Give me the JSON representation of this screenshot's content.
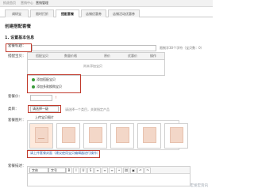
{
  "topbar": {
    "breadcrumb": [
      "抓虎首页",
      "营销中心",
      "营销管理"
    ]
  },
  "tabs": [
    {
      "label": "调研宝"
    },
    {
      "label": "限时打折"
    },
    {
      "label": "搭配套餐"
    },
    {
      "label": "店铺优惠券"
    },
    {
      "label": "店铺活动优惠券"
    }
  ],
  "page": {
    "title": "创建搭配套餐",
    "section": "1. 设置基本信息"
  },
  "form": {
    "name_label": "套餐标题：",
    "name_value": "",
    "name_hint": "限制字30个字符（宝贝数：0）",
    "items_label": "搭配宝贝：",
    "table_headers": [
      "搭配宝贝",
      "数量价格",
      "原价",
      "优惠价",
      "操作"
    ],
    "table_empty": "尚未添加宝贝",
    "add_main": "添加搭配宝贝",
    "add_multi": "添加多款换购宝贝",
    "price_label": "套餐价：",
    "cat_label": "类目：",
    "cat_select": "请选择一级",
    "cat_hint": "请选择一个类目，关联指定产品",
    "image_label": "套餐图片：",
    "image_tab": "上传宝贝图片",
    "image_hint": "请上传套餐封面（建议使用宝贝编辑器进行操作）",
    "desc_label": "套餐描述：",
    "editor_font": "字体",
    "editor_size": "字号"
  },
  "watermark": "宏发宏资讯"
}
